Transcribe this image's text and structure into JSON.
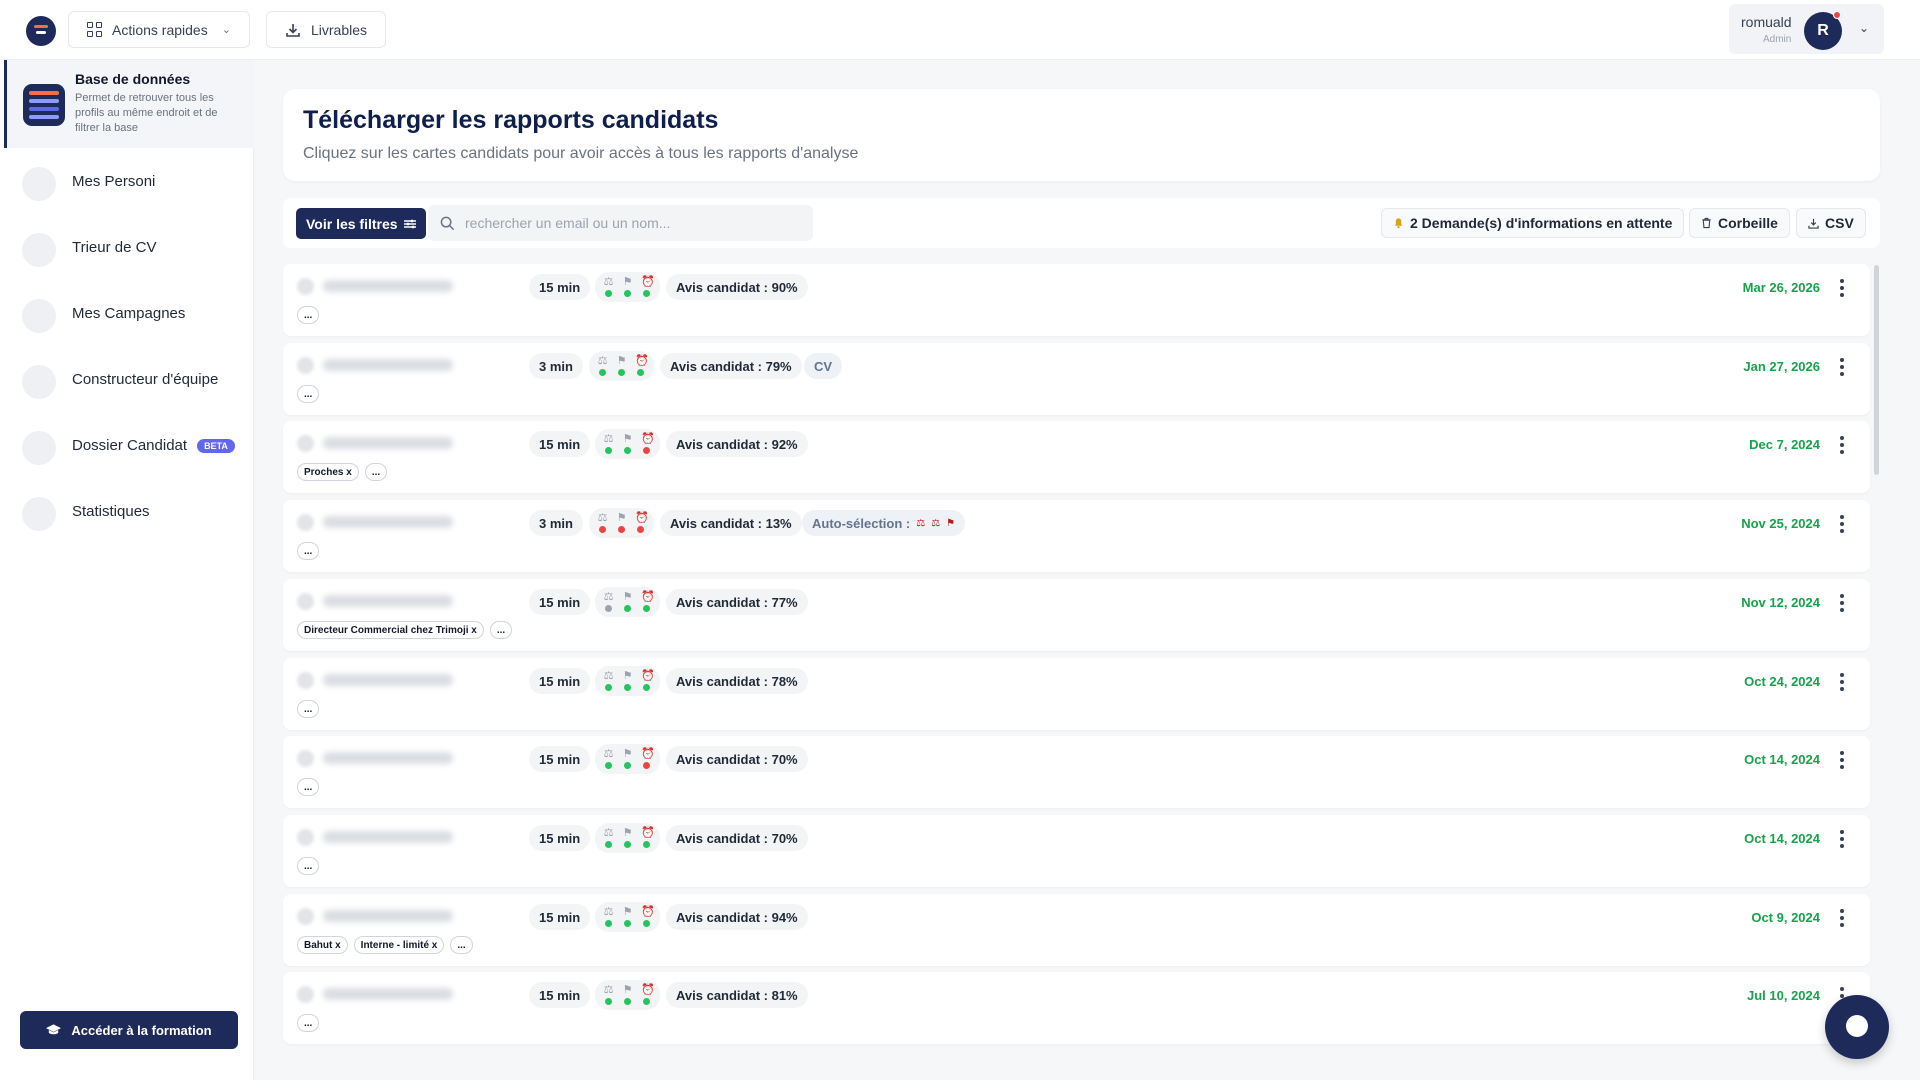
{
  "topbar": {
    "quick_actions_label": "Actions rapides",
    "deliverables_label": "Livrables",
    "user_name": "romuald",
    "user_role": "Admin",
    "avatar_initial": "R"
  },
  "sidebar": {
    "active": {
      "title": "Base de données",
      "description": "Permet de retrouver tous les profils au même endroit et de filtrer la base"
    },
    "items": [
      {
        "label": "Mes Personi"
      },
      {
        "label": "Trieur de CV"
      },
      {
        "label": "Mes Campagnes"
      },
      {
        "label": "Constructeur d'équipe"
      },
      {
        "label": "Dossier Candidat",
        "badge": "BETA"
      },
      {
        "label": "Statistiques"
      }
    ],
    "formation_label": "Accéder à la formation"
  },
  "header": {
    "title": "Télécharger les rapports candidats",
    "subtitle": "Cliquez sur les cartes candidats pour avoir accès à tous les rapports d'analyse"
  },
  "toolbar": {
    "filters_label": "Voir les filtres",
    "search_placeholder": "rechercher un email ou un nom...",
    "requests_label": "2 Demande(s) d'informations en attente",
    "trash_label": "Corbeille",
    "csv_label": "CSV"
  },
  "colors": {
    "primary": "#1e2a5a",
    "date_green": "#16a34a",
    "dot_green": "#22c55e",
    "dot_red": "#ef4444",
    "dot_gray": "#9ca3af",
    "accent_red": "#ef4444"
  },
  "rows": [
    {
      "duration": "15 min",
      "avis": "Avis candidat : 90%",
      "date": "Mar 26, 2026",
      "dots": [
        "green",
        "green",
        "green"
      ],
      "tags": [
        "..."
      ]
    },
    {
      "duration": "3 min",
      "avis": "Avis candidat : 79%",
      "extra": "CV",
      "date": "Jan 27, 2026",
      "dots": [
        "green",
        "green",
        "green"
      ],
      "tags": [
        "..."
      ]
    },
    {
      "duration": "15 min",
      "avis": "Avis candidat : 92%",
      "date": "Dec 7, 2024",
      "dots": [
        "green",
        "green",
        "red"
      ],
      "tags": [
        "Proches x",
        "..."
      ]
    },
    {
      "duration": "3 min",
      "avis": "Avis candidat : 13%",
      "extra": "Auto-sélection :",
      "date": "Nov 25, 2024",
      "dots": [
        "red",
        "red",
        "red"
      ],
      "tags": [
        "..."
      ]
    },
    {
      "duration": "15 min",
      "avis": "Avis candidat : 77%",
      "date": "Nov 12, 2024",
      "dots": [
        "gray",
        "green",
        "green"
      ],
      "tags": [
        "Directeur Commercial chez Trimoji x",
        "..."
      ]
    },
    {
      "duration": "15 min",
      "avis": "Avis candidat : 78%",
      "date": "Oct 24, 2024",
      "dots": [
        "green",
        "green",
        "green"
      ],
      "tags": [
        "..."
      ]
    },
    {
      "duration": "15 min",
      "avis": "Avis candidat : 70%",
      "date": "Oct 14, 2024",
      "dots": [
        "green",
        "green",
        "red"
      ],
      "tags": [
        "..."
      ]
    },
    {
      "duration": "15 min",
      "avis": "Avis candidat : 70%",
      "date": "Oct 14, 2024",
      "dots": [
        "green",
        "green",
        "green"
      ],
      "tags": [
        "..."
      ]
    },
    {
      "duration": "15 min",
      "avis": "Avis candidat : 94%",
      "date": "Oct 9, 2024",
      "dots": [
        "green",
        "green",
        "green"
      ],
      "tags": [
        "Bahut x",
        "Interne - limité x",
        "..."
      ]
    },
    {
      "duration": "15 min",
      "avis": "Avis candidat : 81%",
      "date": "Jul 10, 2024",
      "dots": [
        "green",
        "green",
        "green"
      ],
      "tags": [
        "..."
      ]
    }
  ]
}
